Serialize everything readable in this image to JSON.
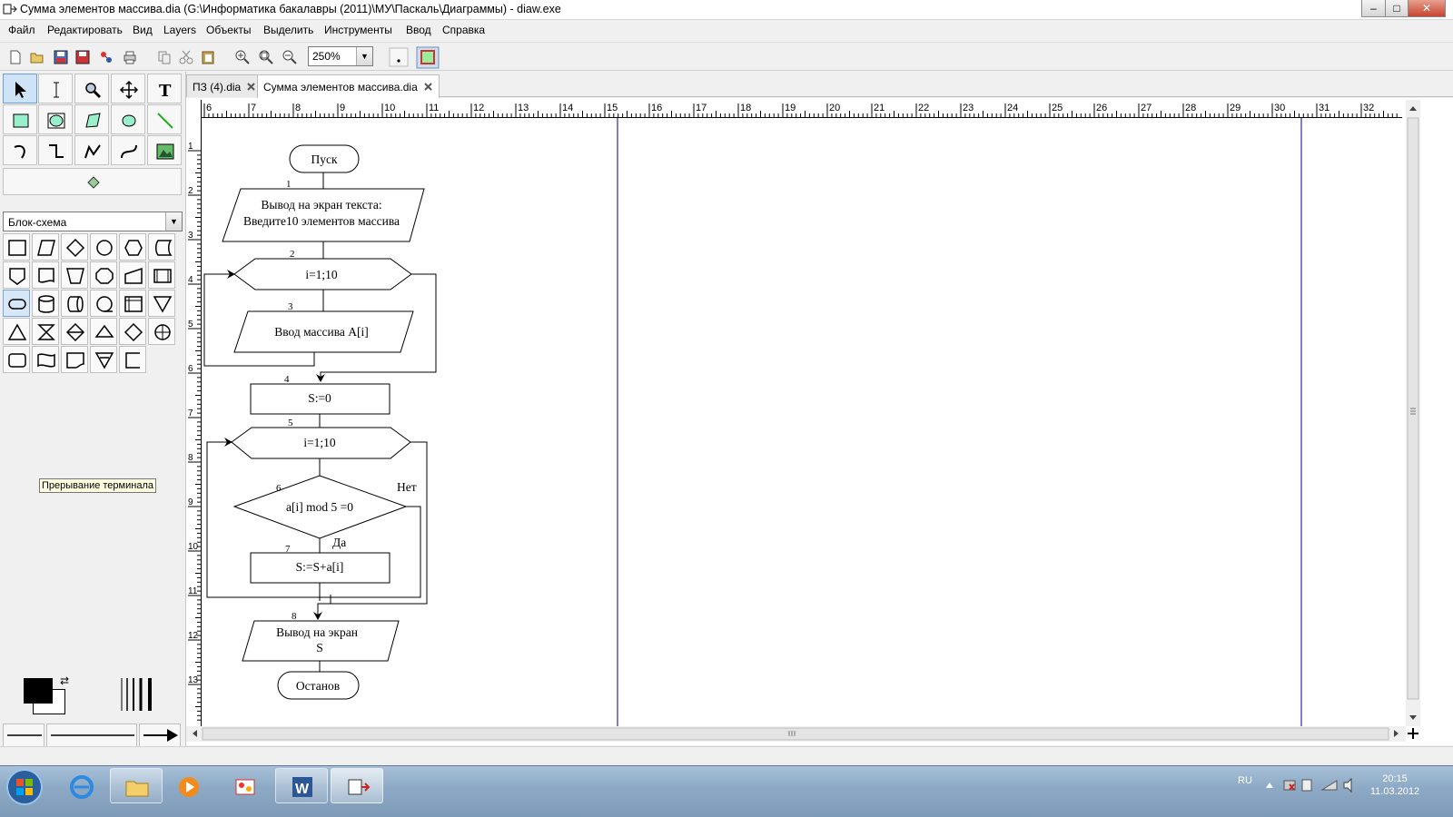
{
  "window": {
    "title": "Сумма элементов массива.dia (G:\\Информатика бакалавры (2011)\\МУ\\Паскаль\\Диаграммы) - diaw.exe",
    "minimize": "–",
    "maximize": "□",
    "close": "✕"
  },
  "menu": {
    "items": [
      "Файл",
      "Редактировать",
      "Вид",
      "Layers",
      "Объекты",
      "Выделить",
      "Инструменты",
      "Ввод",
      "Справка"
    ]
  },
  "toolbar": {
    "zoom_value": "250%",
    "icons": [
      "new-icon",
      "open-icon",
      "save-icon",
      "save-as-icon",
      "export-icon",
      "print-icon",
      "copy-icon",
      "cut-icon",
      "paste-icon",
      "zoom-in-icon",
      "zoom-fit-icon",
      "zoom-out-icon",
      "snap-grid-icon",
      "snap-object-icon"
    ]
  },
  "toolbox": {
    "sheet_selector": "Блок-схема",
    "tooltip": "Прерывание терминала",
    "tools": [
      "pointer-tool",
      "text-edit-tool",
      "magnify-tool",
      "scroll-tool",
      "text-tool",
      "box-tool",
      "ellipse-tool",
      "polygon-tool",
      "beziergon-tool",
      "line-tool",
      "arc-tool",
      "zigzag-line-tool",
      "polyline-tool",
      "bezier-line-tool",
      "image-tool",
      "outline-tool"
    ]
  },
  "tabs": [
    {
      "label": "ПЗ (4).dia",
      "active": false
    },
    {
      "label": "Сумма элементов массива.dia",
      "active": true
    }
  ],
  "ruler": {
    "h_labels": [
      "6",
      "7",
      "8",
      "9",
      "10",
      "11",
      "12",
      "13",
      "14",
      "15",
      "16",
      "17",
      "18",
      "19",
      "20",
      "21",
      "22",
      "23",
      "24",
      "25",
      "26",
      "27",
      "28",
      "29",
      "30",
      "31",
      "32"
    ],
    "v_labels": [
      "1",
      "2",
      "3",
      "4",
      "5",
      "6",
      "7",
      "8",
      "9",
      "10",
      "11",
      "12",
      "13"
    ]
  },
  "flowchart": {
    "start": "Пуск",
    "n1": "1",
    "output1_line1": "Вывод на экран текста:",
    "output1_line2": "Введите10 элементов массива",
    "n2": "2",
    "loop1": "i=1;10",
    "n3": "3",
    "input": "Ввод  массива  A[i]",
    "n4": "4",
    "assign": "S:=0",
    "n5": "5",
    "loop2": "i=1;10",
    "n6": "6",
    "condition": "a[i] mod 5 =0",
    "no_label": "Нет",
    "yes_label": "Да",
    "n7": "7",
    "sum": "S:=S+a[i]",
    "n8": "8",
    "output2_line1": "Вывод  на экран",
    "output2_line2": "S",
    "stop": "Останов"
  },
  "statusbar": {
    "text": ""
  },
  "taskbar": {
    "lang": "RU",
    "time": "20:15",
    "date": "11.03.2012",
    "apps": [
      "start-button",
      "internet-explorer",
      "explorer",
      "media-player",
      "paint",
      "word",
      "dia"
    ]
  },
  "colors": {
    "accent": "#3a6ea5",
    "page_border": "#00008b",
    "taskbar": "#8eaac6"
  }
}
